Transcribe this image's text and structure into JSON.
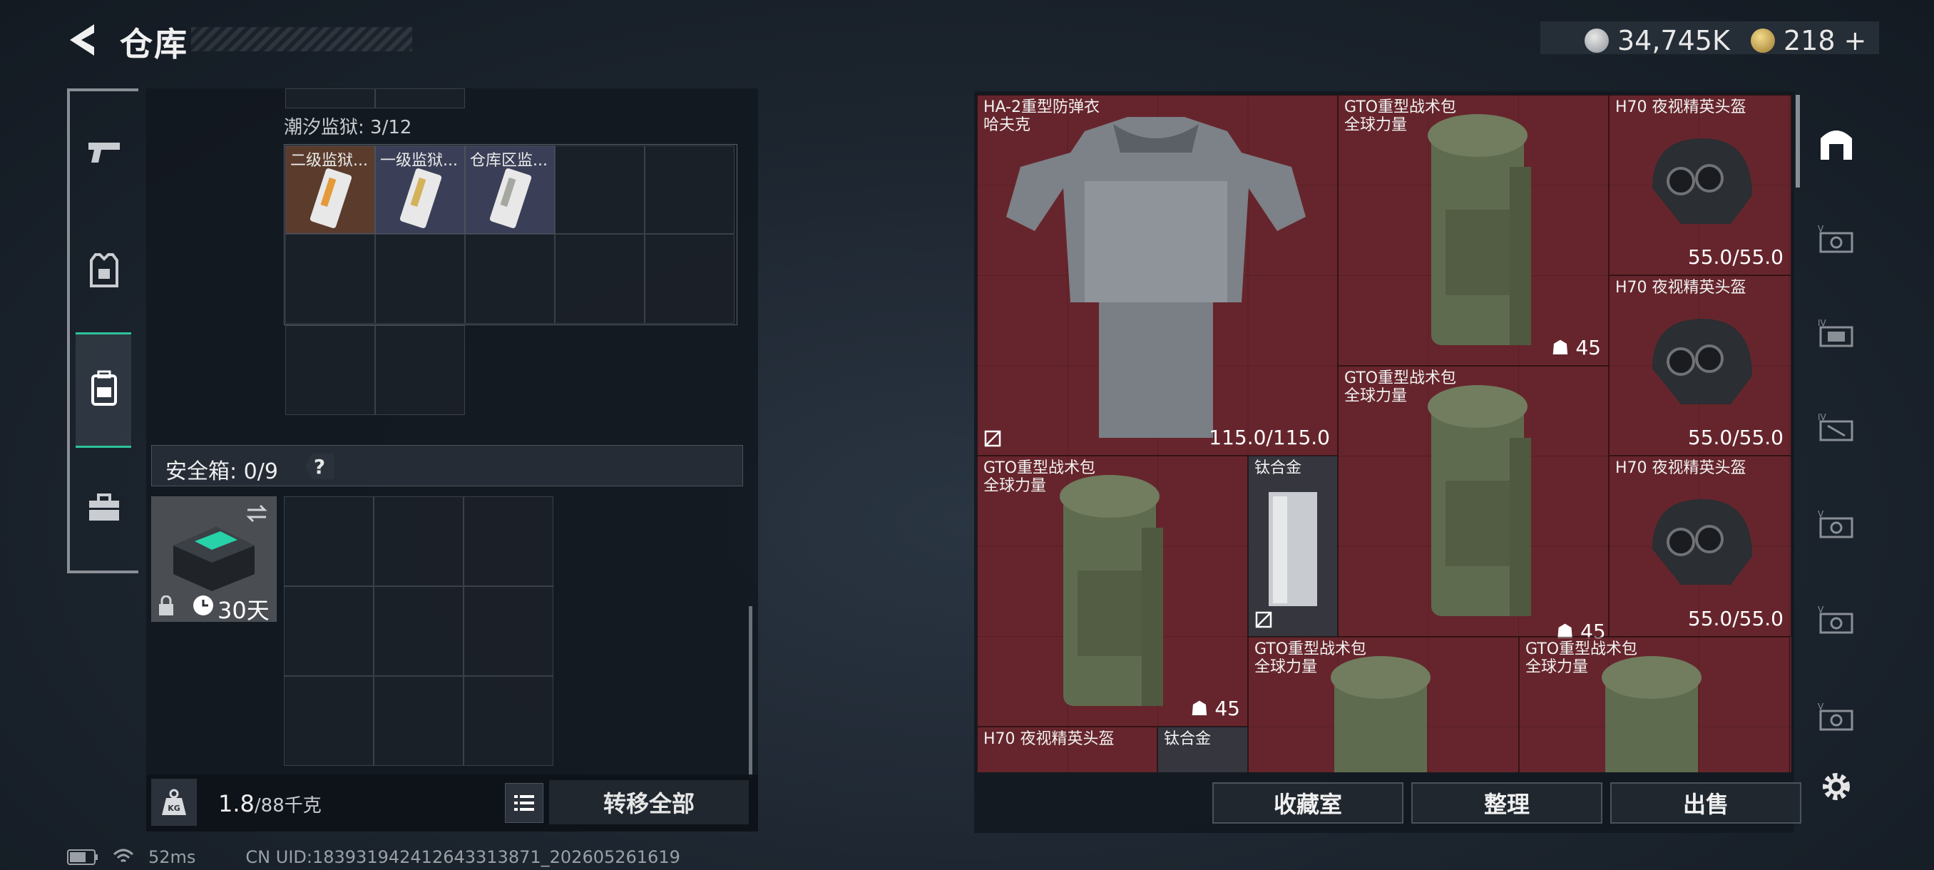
{
  "header": {
    "title": "仓库"
  },
  "currency": [
    {
      "icon": "silver-coin-icon",
      "value": "34,745K"
    },
    {
      "icon": "gold-coin-icon",
      "value": "218",
      "plus": "+"
    }
  ],
  "sidebar": {
    "items": [
      {
        "name": "weapons-tab",
        "icon": "pistol-icon"
      },
      {
        "name": "equipment-tab",
        "icon": "armor-vest-icon"
      },
      {
        "name": "backpack-tab",
        "icon": "backpack-icon",
        "selected": true
      },
      {
        "name": "toolbox-tab",
        "icon": "briefcase-icon"
      }
    ]
  },
  "left": {
    "collection_label": "潮汐监狱: 3/12",
    "keys": [
      {
        "name": "二级监狱..."
      },
      {
        "name": "一级监狱..."
      },
      {
        "name": "仓库区监..."
      }
    ],
    "safe_box_label": "安全箱: 0/9",
    "safe_box_help": "?",
    "safe_box_timer": "30天",
    "weight_current": "1.8",
    "weight_max": "/88千克",
    "transfer_all": "转移全部"
  },
  "inventory": {
    "items": [
      {
        "name": "HA-2重型防弹衣",
        "sub": "哈夫克",
        "value": "115.0/115.0"
      },
      {
        "name": "GTO重型战术包",
        "sub": "全球力量",
        "value": "45"
      },
      {
        "name": "H70 夜视精英头盔",
        "sub": "",
        "value": "55.0/55.0"
      },
      {
        "name": "H70 夜视精英头盔",
        "sub": "",
        "value": "55.0/55.0"
      },
      {
        "name": "GTO重型战术包",
        "sub": "全球力量",
        "value": "45"
      },
      {
        "name": "H70 夜视精英头盔",
        "sub": "",
        "value": "55.0/55.0"
      },
      {
        "name": "GTO重型战术包",
        "sub": "全球力量",
        "value": "45"
      },
      {
        "name": "钛合金",
        "sub": "",
        "value": ""
      },
      {
        "name": "GTO重型战术包",
        "sub": "全球力量",
        "value": ""
      },
      {
        "name": "GTO重型战术包",
        "sub": "全球力量",
        "value": ""
      },
      {
        "name": "H70 夜视精英头盔",
        "sub": "",
        "value": ""
      },
      {
        "name": "钛合金",
        "sub": "",
        "value": ""
      }
    ]
  },
  "actions": {
    "collection": "收藏室",
    "organize": "整理",
    "sell": "出售"
  },
  "status": {
    "ping": "52ms",
    "uid": "CN UID:183931942412643313871_202605261619"
  },
  "colors": {
    "accent": "#2ec29a",
    "inventory_bg": "#5e2228"
  }
}
